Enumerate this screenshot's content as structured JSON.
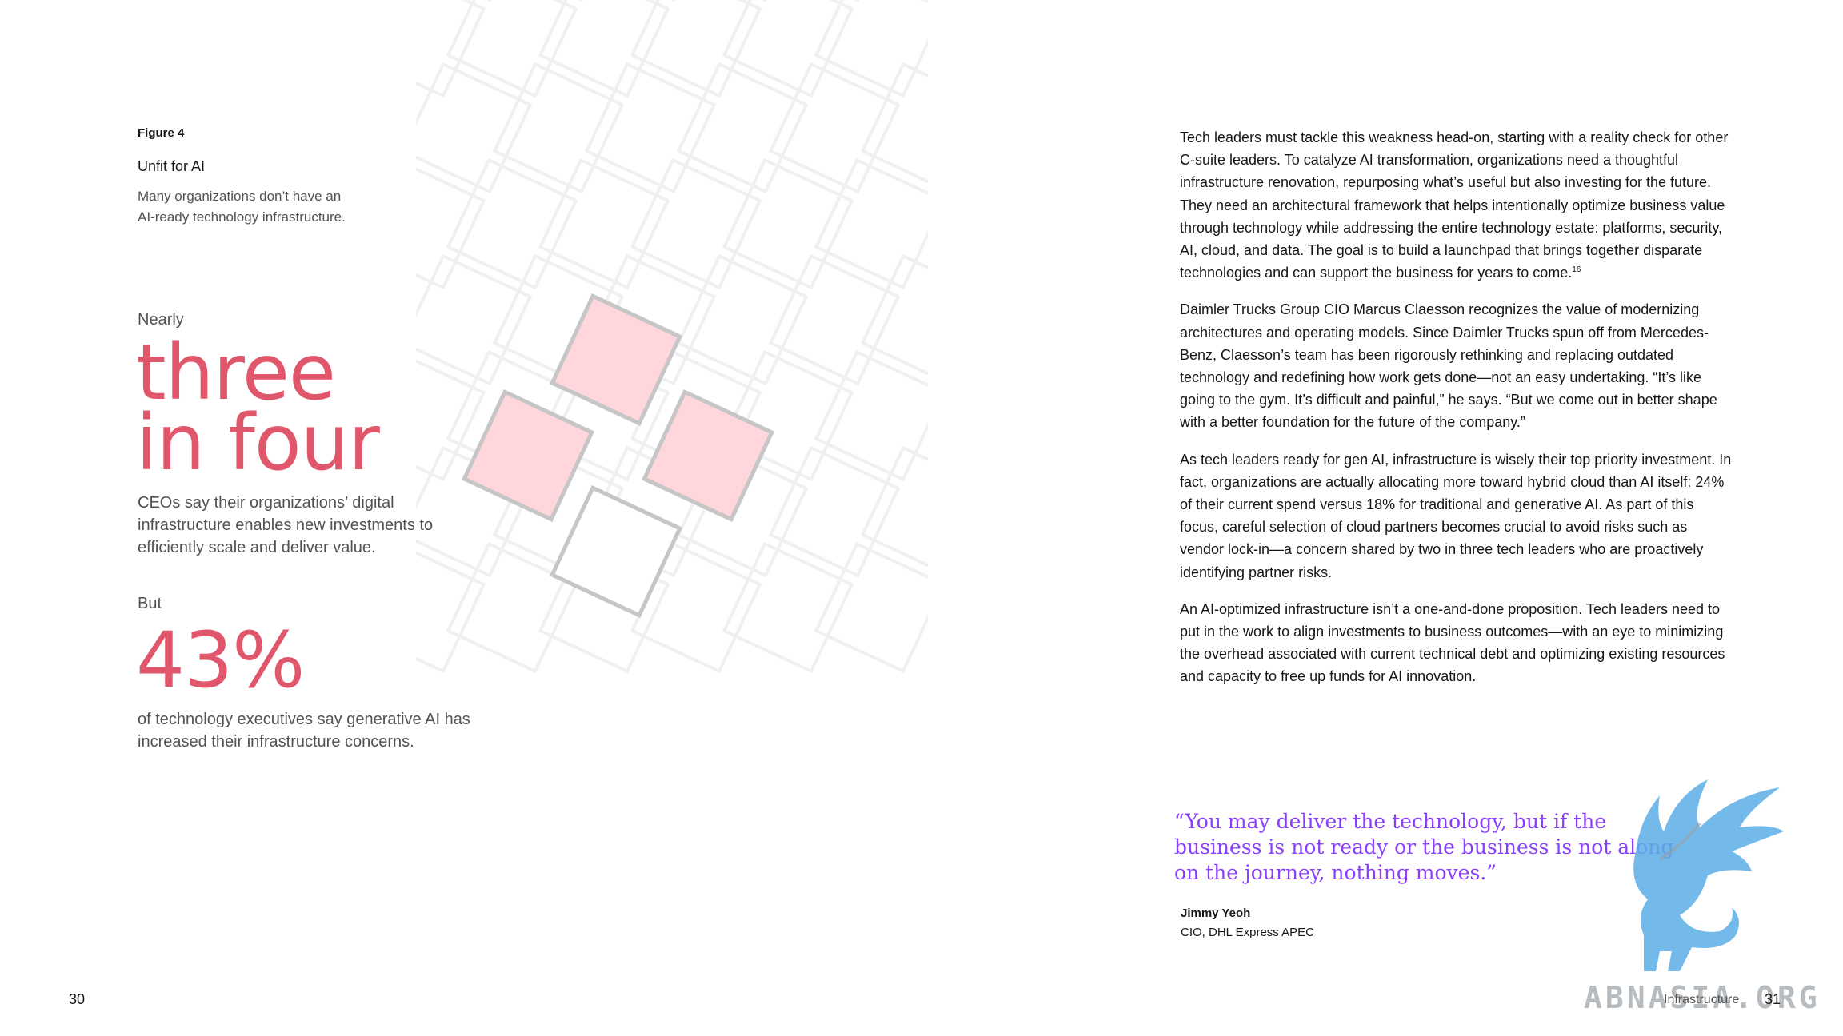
{
  "figure": {
    "label": "Figure 4",
    "title": "Unfit for AI",
    "subtitle": "Many organizations don’t have an AI-ready technology infrastructure."
  },
  "stat1": {
    "prefix": "Nearly",
    "line1": "three",
    "line2": "in four",
    "description": "CEOs say their organizations’ digital infrastructure enables new investments to efficiently scale and deliver value."
  },
  "stat2": {
    "prefix": "But",
    "value": "43%",
    "description": "of technology executives say generative AI has increased their infrastructure concerns."
  },
  "pattern": {
    "highlight_color": "#ffd6dc",
    "highlight_stroke": "#c6c6c6",
    "grid_stroke": "#eef0f2",
    "highlighted_count": 3
  },
  "body": {
    "p1": "Tech leaders must tackle this weakness head-on, starting with a reality check for other C-suite leaders. To catalyze AI transformation, organizations need a thoughtful infrastructure renovation, repurposing what’s useful but also investing for the future. They need an architectural framework that helps intentionally optimize business value through technology while addressing the entire technology estate: platforms, security, AI, cloud, and data. The goal is to build a launchpad that brings together disparate technologies and can support the business for years to come.",
    "p1_ref": "16",
    "p2": "Daimler Trucks Group CIO Marcus Claesson recognizes the value of modernizing architectures and operating models. Since Daimler Trucks spun off from Mercedes-Benz, Claesson’s team has been rigorously rethinking and replacing outdated technology and redefining how work gets done—not an easy undertaking. “It’s like going to the gym. It’s difficult and painful,” he says. “But we come out in better shape with a better foundation for the future of the company.”",
    "p3": "As tech leaders ready for gen AI, infrastructure is wisely their top priority investment. In fact, organizations are actually allocating more toward hybrid cloud than AI itself: 24% of their current spend versus 18% for traditional and generative AI. As part of this focus, careful selection of cloud partners becomes crucial to avoid risks such as vendor lock-in—a concern shared by two in three tech leaders who are proactively identifying partner risks.",
    "p4": "An AI-optimized infrastructure isn’t a one-and-done proposition. Tech leaders need to put in the work to align investments to business outcomes—with an eye to minimizing the overhead associated with current technical debt and optimizing existing resources and capacity to free up funds for AI innovation."
  },
  "quote": {
    "text": "“You may deliver the technology, but if the business is not ready or the business is not along on the journey, nothing moves.”",
    "name": "Jimmy Yeoh",
    "role": "CIO, DHL Express APEC"
  },
  "footer": {
    "left_page": "30",
    "section": "Infrastructure",
    "right_page": "31"
  },
  "watermark": {
    "text": "ABNASIA.ORG",
    "color": "#5aaee8"
  }
}
